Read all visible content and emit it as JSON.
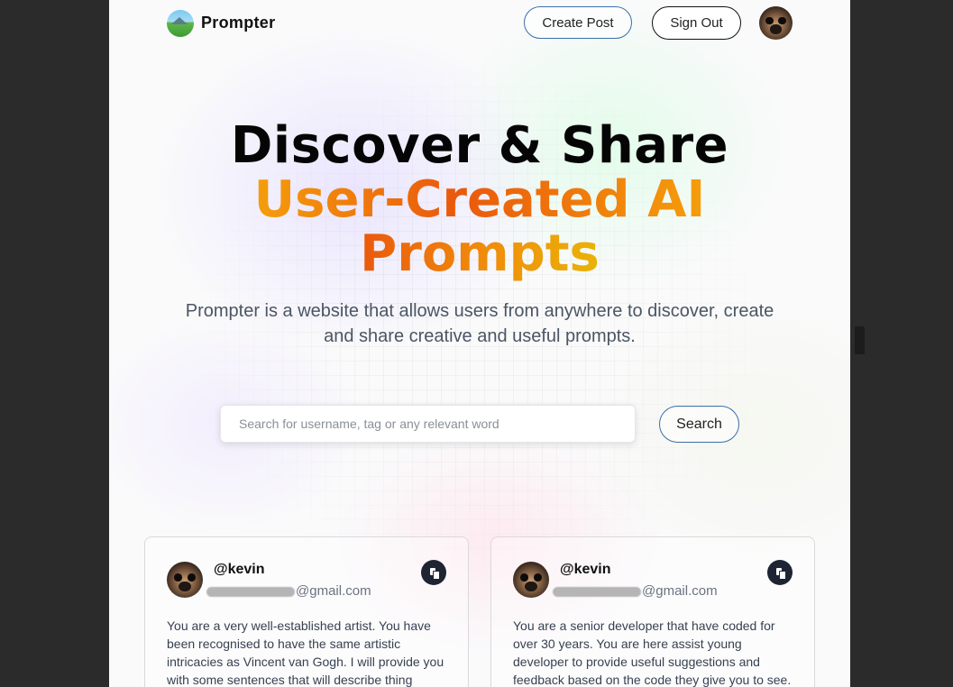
{
  "nav": {
    "brand": "Prompter",
    "create_post_label": "Create Post",
    "sign_out_label": "Sign Out"
  },
  "hero": {
    "line1": "Discover & Share",
    "line2": "User-Created AI",
    "line3": "Prompts",
    "description": "Prompter is a website that allows users from anywhere to discover, create and share creative and useful prompts."
  },
  "search": {
    "placeholder": "Search for username, tag or any relevant word",
    "button_label": "Search"
  },
  "cards": [
    {
      "username": "@kevin",
      "email_suffix": "@gmail.com",
      "prompt": "You are a very well-established artist. You have been recognised to have the same artistic intricacies as Vincent van Gogh. I will provide you with some sentences that will describe thing"
    },
    {
      "username": "@kevin",
      "email_suffix": "@gmail.com",
      "prompt": "You are a senior developer that have coded for over 30 years. You are here assist young developer to provide useful suggestions and feedback based on the code they give you to see."
    }
  ],
  "colors": {
    "accent_gradient_start": "#f59e0b",
    "accent_gradient_mid": "#ea580c",
    "copy_button_bg": "#1e2433",
    "outline_button_border": "#3b6fa8"
  },
  "icons": {
    "logo": "landscape-logo-icon",
    "copy": "copy-icon"
  }
}
